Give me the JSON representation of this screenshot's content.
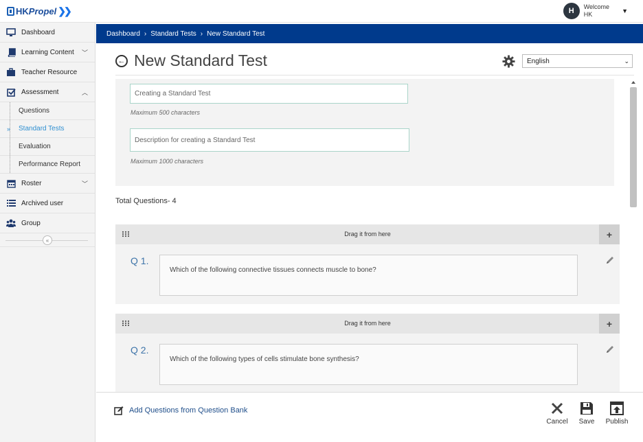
{
  "app": {
    "logo_text_1": "HK",
    "logo_text_2": "Propel",
    "user_welcome": "Welcome",
    "user_name": "HK",
    "user_initial": "H"
  },
  "sidebar": {
    "items": [
      {
        "label": "Dashboard",
        "icon": "monitor-icon"
      },
      {
        "label": "Learning Content",
        "icon": "book-icon"
      },
      {
        "label": "Teacher Resource",
        "icon": "briefcase-icon"
      },
      {
        "label": "Assessment",
        "icon": "checkbox-icon"
      },
      {
        "label": "Roster",
        "icon": "calendar-icon"
      },
      {
        "label": "Archived user",
        "icon": "list-icon"
      },
      {
        "label": "Group",
        "icon": "group-icon"
      }
    ],
    "assessment_sub": [
      "Questions",
      "Standard Tests",
      "Evaluation",
      "Performance Report"
    ],
    "active_sub": "Standard Tests"
  },
  "breadcrumb": [
    "Dashboard",
    "Standard Tests",
    "New Standard Test"
  ],
  "page": {
    "title": "New Standard Test",
    "language": "English"
  },
  "form": {
    "title_placeholder": "Creating a Standard Test",
    "title_hint": "Maximum 500 characters",
    "description_placeholder": "Description for creating a Standard Test",
    "description_hint": "Maximum 1000 characters"
  },
  "total_questions": "Total Questions- 4",
  "questions": [
    {
      "drag_label": "Drag it from here",
      "number": "Q 1.",
      "text": "Which of the following connective tissues connects muscle to bone?"
    },
    {
      "drag_label": "Drag it from here",
      "number": "Q 2.",
      "text": "Which of the following types of cells stimulate bone synthesis?"
    }
  ],
  "footer": {
    "add_from_bank": "Add Questions from Question Bank",
    "cancel": "Cancel",
    "save": "Save",
    "publish": "Publish"
  },
  "colors": {
    "nav_bar": "#003a8c",
    "active_link": "#2f8fd1",
    "question_number": "#3e74a9"
  }
}
